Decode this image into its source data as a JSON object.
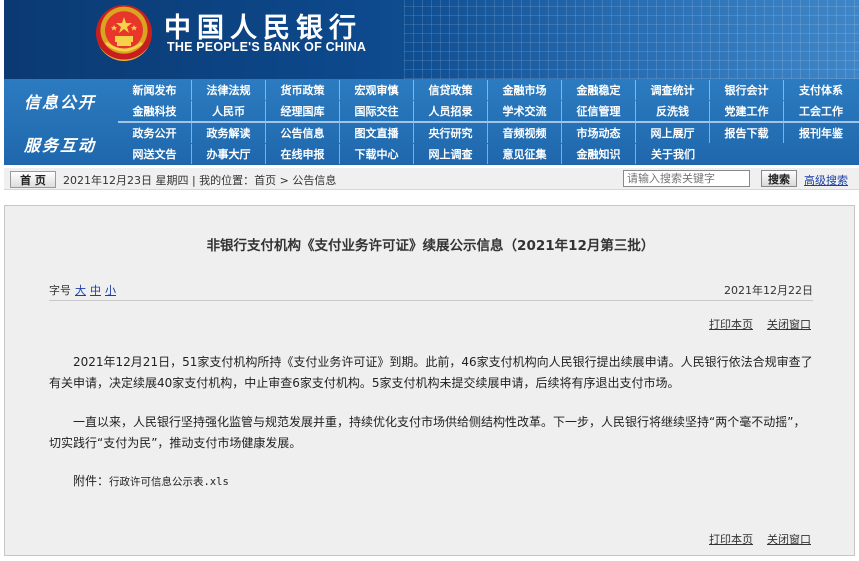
{
  "header": {
    "title_cn": "中国人民银行",
    "title_en": "THE PEOPLE'S BANK OF CHINA",
    "emblem_icon": "national-emblem-icon"
  },
  "nav": {
    "group1_label": "信息公开",
    "group2_label": "服务互动",
    "row1": [
      "新闻发布",
      "法律法规",
      "货币政策",
      "宏观审慎",
      "信贷政策",
      "金融市场",
      "金融稳定",
      "调查统计",
      "银行会计",
      "支付体系"
    ],
    "row2": [
      "金融科技",
      "人民币",
      "经理国库",
      "国际交往",
      "人员招录",
      "学术交流",
      "征信管理",
      "反洗钱",
      "党建工作",
      "工会工作"
    ],
    "row3": [
      "政务公开",
      "政务解读",
      "公告信息",
      "图文直播",
      "央行研究",
      "音频视频",
      "市场动态",
      "网上展厅",
      "报告下载",
      "报刊年鉴"
    ],
    "row4": [
      "网送文告",
      "办事大厅",
      "在线申报",
      "下载中心",
      "网上调查",
      "意见征集",
      "金融知识",
      "关于我们"
    ]
  },
  "infobar": {
    "home_label": "首 页",
    "date_location": "2021年12月23日 星期四 | 我的位置：首页 > 公告信息",
    "search_placeholder": "请输入搜索关键字",
    "search_button": "搜索",
    "advanced_search": "高级搜索"
  },
  "article": {
    "title": "非银行支付机构《支付业务许可证》续展公示信息（2021年12月第三批）",
    "font_size_label": "字号",
    "font_sizes": [
      "大",
      "中",
      "小"
    ],
    "pub_date": "2021年12月22日",
    "print_label": "打印本页",
    "close_label": "关闭窗口",
    "paragraph1": "2021年12月21日，51家支付机构所持《支付业务许可证》到期。此前，46家支付机构向人民银行提出续展申请。人民银行依法合规审查了有关申请，决定续展40家支付机构，中止审查6家支付机构。5家支付机构未提交续展申请，后续将有序退出支付市场。",
    "paragraph2": "一直以来，人民银行坚持强化监管与规范发展并重，持续优化支付市场供给侧结构性改革。下一步，人民银行将继续坚持“两个毫不动摇”，切实践行“支付为民”，推动支付市场健康发展。",
    "attachment_label": "附件：",
    "attachment_file": "行政许可信息公示表.xls"
  },
  "colors": {
    "banner_dark": "#0b3a72",
    "nav_blue": "#1f67ad",
    "link_blue": "#1a3fa6",
    "content_bg": "#efefef"
  }
}
